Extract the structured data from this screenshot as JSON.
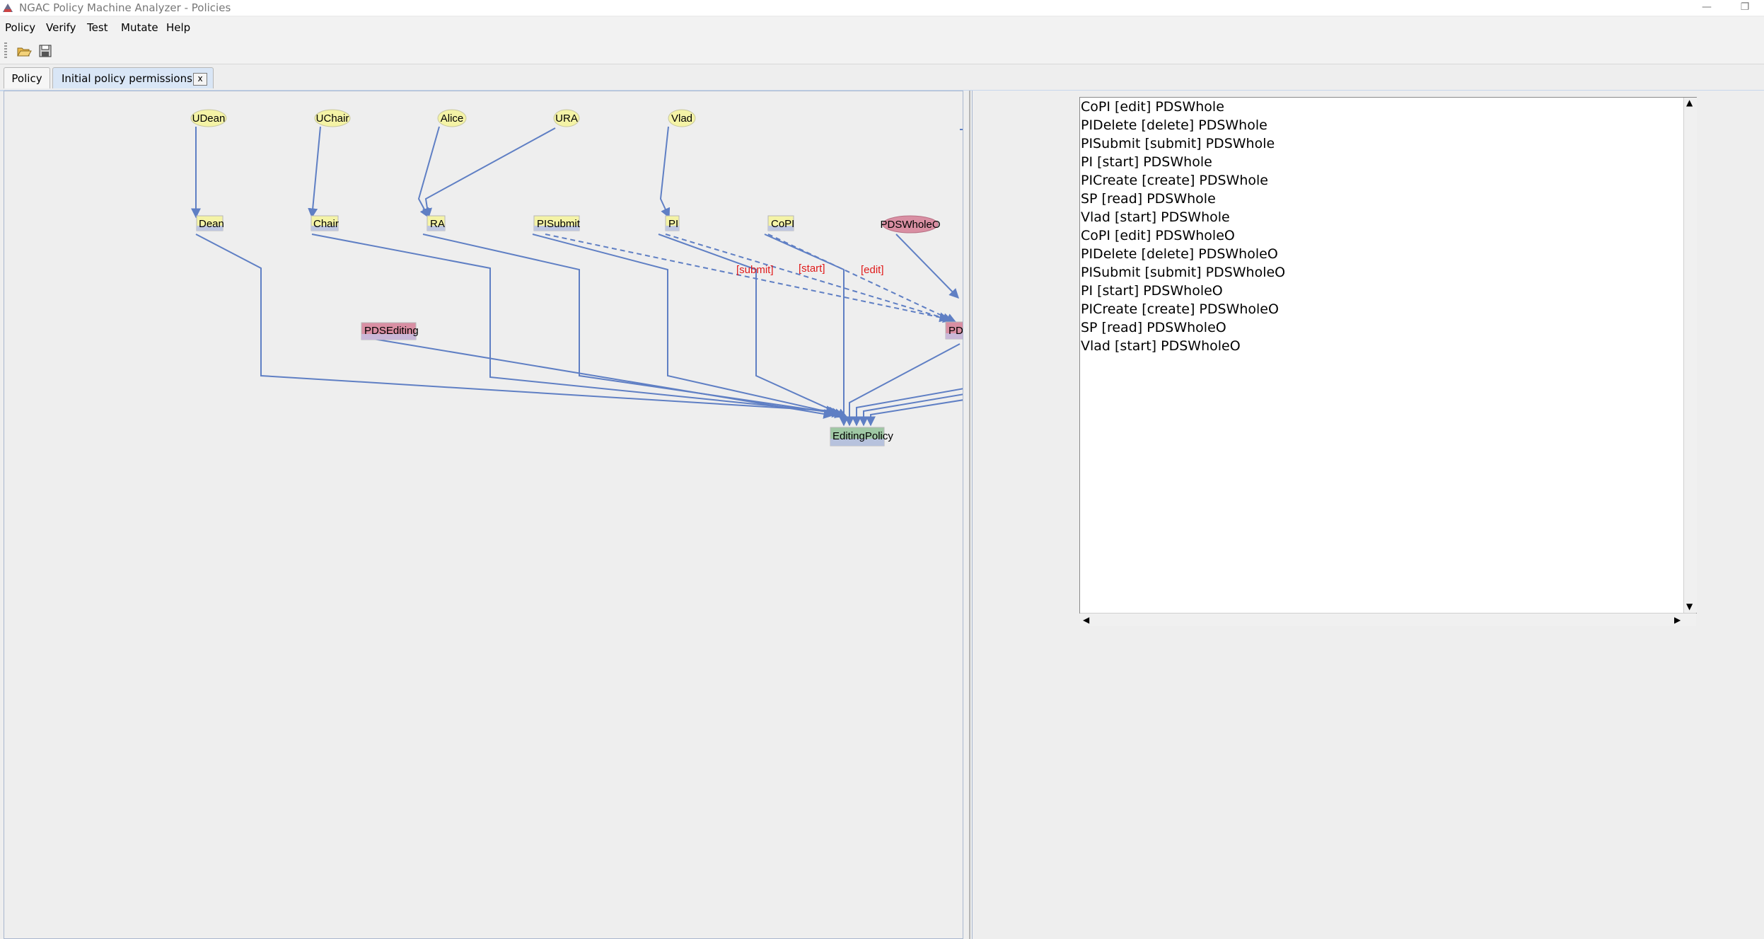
{
  "window": {
    "title": "NGAC Policy Machine Analyzer - Policies",
    "minimize_glyph": "—",
    "restore_glyph": "❐"
  },
  "menu": {
    "items": [
      "Policy",
      "Verify",
      "Test",
      "Mutate",
      "Help"
    ]
  },
  "toolbar": {
    "buttons": [
      {
        "icon": "open-folder-icon"
      },
      {
        "icon": "save-disk-icon"
      }
    ]
  },
  "tabs": [
    {
      "label": "Policy",
      "active": false
    },
    {
      "label": "Initial policy permissions",
      "active": true,
      "close_label": "x"
    }
  ],
  "graph": {
    "nodes": {
      "udean": "UDean",
      "uchair": "UChair",
      "alice": "Alice",
      "ura": "URA",
      "vlad": "Vlad",
      "dean": "Dean",
      "chair": "Chair",
      "ra": "RA",
      "pisubmit": "PISubmit",
      "pi": "PI",
      "copi": "CoPI",
      "pdswholeo": "PDSWholeO",
      "pdsediting": "PDSEditing",
      "pd_partial": "PD",
      "editingpolicy": "EditingPolicy"
    },
    "edge_labels": {
      "submit": "[submit]",
      "start": "[start]",
      "edit": "[edit]"
    },
    "colors": {
      "user_node": "#f4f3a6",
      "user_attr_node": "#f4f3a6",
      "object_node": "#d98fa3",
      "policy_node": "#9fc8a4",
      "edge": "#5f7fc4",
      "edge_label": "#e01a1a"
    }
  },
  "permissions": {
    "lines": [
      "CoPI [edit] PDSWhole",
      "PIDelete [delete] PDSWhole",
      "PISubmit [submit] PDSWhole",
      "PI [start] PDSWhole",
      "PICreate [create] PDSWhole",
      "SP [read] PDSWhole",
      "Vlad [start] PDSWhole",
      "CoPI [edit] PDSWholeO",
      "PIDelete [delete] PDSWholeO",
      "PISubmit [submit] PDSWholeO",
      "PI [start] PDSWholeO",
      "PICreate [create] PDSWholeO",
      "SP [read] PDSWholeO",
      "Vlad [start] PDSWholeO"
    ]
  }
}
